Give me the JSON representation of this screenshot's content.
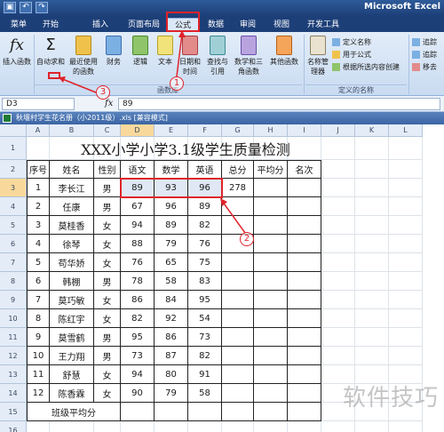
{
  "app_title": "Microsoft Excel",
  "qat": [
    "save-icon",
    "undo-icon",
    "redo-icon"
  ],
  "tabs": [
    {
      "label": "菜单"
    },
    {
      "label": "开始"
    },
    {
      "label": "插入"
    },
    {
      "label": "页面布局"
    },
    {
      "label": "公式",
      "active": true
    },
    {
      "label": "数据"
    },
    {
      "label": "审阅"
    },
    {
      "label": "视图"
    },
    {
      "label": "开发工具"
    }
  ],
  "ribbon": {
    "insert_function": "插入函数",
    "autosum": "自动求和",
    "recent": "最近使用的函数",
    "financial": "财务",
    "logical": "逻辑",
    "text": "文本",
    "datetime": "日期和时间",
    "lookup": "查找与引用",
    "math": "数学和三角函数",
    "other": "其他函数",
    "group_library": "函数库",
    "name_manager": "名称管理器",
    "define_name": "定义名称",
    "use_in_formula": "用于公式",
    "create_from_sel": "根据所选内容创建",
    "group_defined_names": "定义的名称",
    "trace_prec": "追踪",
    "trace_dep": "追踪",
    "remove_arrows": "移去"
  },
  "formula_bar": {
    "name_box": "D3",
    "fx": "fx",
    "value": "89"
  },
  "document_title": "秋堰村学生花名册（小2011级）.xls [兼容模式]",
  "columns": [
    "A",
    "B",
    "C",
    "D",
    "E",
    "F",
    "G",
    "H",
    "I",
    "J",
    "K",
    "L"
  ],
  "rows": [
    "1",
    "2",
    "3",
    "4",
    "5",
    "6",
    "7",
    "8",
    "9",
    "10",
    "11",
    "12",
    "13",
    "14",
    "15",
    "16"
  ],
  "sheet_title": "XXX小学小学3.1级学生质量检测",
  "headers": [
    "序号",
    "姓名",
    "性别",
    "语文",
    "数学",
    "英语",
    "总分",
    "平均分",
    "名次"
  ],
  "students": [
    {
      "no": "1",
      "name": "李长江",
      "sex": "男",
      "chinese": "89",
      "math": "93",
      "english": "96",
      "total": "278"
    },
    {
      "no": "2",
      "name": "任康",
      "sex": "男",
      "chinese": "67",
      "math": "96",
      "english": "89",
      "total": ""
    },
    {
      "no": "3",
      "name": "莫桂香",
      "sex": "女",
      "chinese": "94",
      "math": "89",
      "english": "82",
      "total": ""
    },
    {
      "no": "4",
      "name": "徐琴",
      "sex": "女",
      "chinese": "88",
      "math": "79",
      "english": "76",
      "total": ""
    },
    {
      "no": "5",
      "name": "苟华娇",
      "sex": "女",
      "chinese": "76",
      "math": "65",
      "english": "75",
      "total": ""
    },
    {
      "no": "6",
      "name": "韩棚",
      "sex": "男",
      "chinese": "78",
      "math": "58",
      "english": "83",
      "total": ""
    },
    {
      "no": "7",
      "name": "莫巧敏",
      "sex": "女",
      "chinese": "86",
      "math": "84",
      "english": "95",
      "total": ""
    },
    {
      "no": "8",
      "name": "陈红宇",
      "sex": "女",
      "chinese": "82",
      "math": "92",
      "english": "54",
      "total": ""
    },
    {
      "no": "9",
      "name": "莫雪鹤",
      "sex": "男",
      "chinese": "95",
      "math": "86",
      "english": "73",
      "total": ""
    },
    {
      "no": "10",
      "name": "王力翔",
      "sex": "男",
      "chinese": "73",
      "math": "87",
      "english": "82",
      "total": ""
    },
    {
      "no": "11",
      "name": "舒慧",
      "sex": "女",
      "chinese": "94",
      "math": "80",
      "english": "91",
      "total": ""
    },
    {
      "no": "12",
      "name": "陈香霖",
      "sex": "女",
      "chinese": "90",
      "math": "79",
      "english": "58",
      "total": ""
    }
  ],
  "class_avg_label": "班级平均分",
  "annotations": [
    "1",
    "2",
    "3"
  ],
  "watermark": "软件技巧",
  "colors": {
    "accent": "#e0222a",
    "ribbon": "#dbe8f7",
    "titlebar": "#1d3f78"
  }
}
